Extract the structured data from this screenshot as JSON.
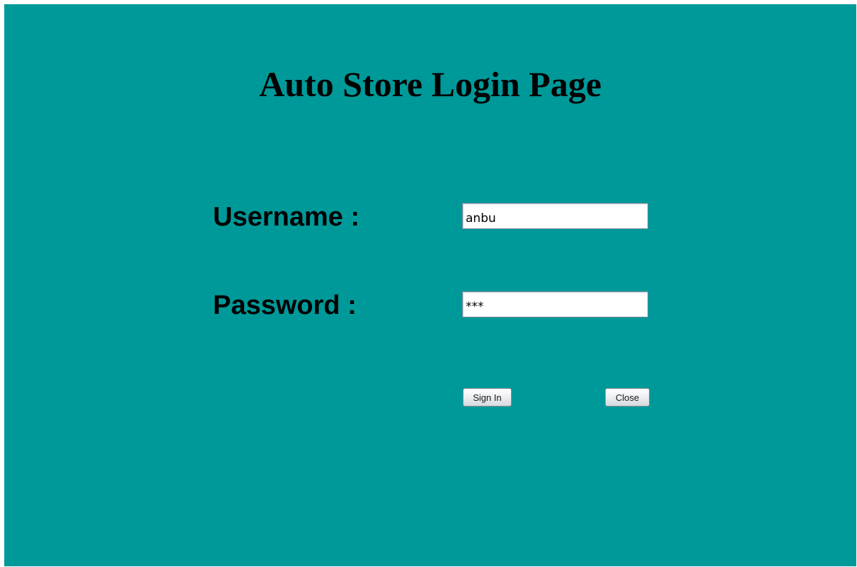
{
  "page": {
    "title": "Auto Store Login Page",
    "background_color": "#009999"
  },
  "form": {
    "username_label": "Username :",
    "username_value": "anbu",
    "password_label": "Password :",
    "password_value": "***"
  },
  "buttons": {
    "sign_in_label": "Sign In",
    "close_label": "Close"
  }
}
